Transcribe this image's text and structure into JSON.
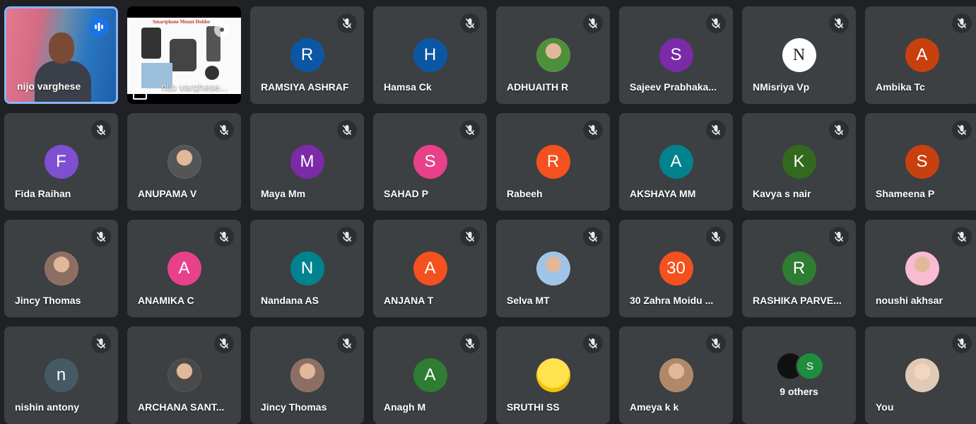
{
  "colors": {
    "tile_bg": "#3c4043",
    "page_bg": "#202124",
    "active_border": "#8ab4f8",
    "speaking": "#1a73e8"
  },
  "self_video": {
    "name": "nijo varghese",
    "icon": "audio-level-icon"
  },
  "presentation": {
    "name": "nijo varghese...",
    "slide_title": "Smartphone Mount Holder",
    "icon": "present-screen-icon"
  },
  "participants": [
    {
      "name": "RAMSIYA ASHRAF",
      "initial": "R",
      "color": "#0b57a3"
    },
    {
      "name": "Hamsa Ck",
      "initial": "H",
      "color": "#0b57a3"
    },
    {
      "name": "ADHUAITH R",
      "initial": "",
      "color": "#4e8f3a",
      "photo": "photo-avatar"
    },
    {
      "name": "Sajeev Prabhaka...",
      "initial": "S",
      "color": "#7b2aa8"
    },
    {
      "name": "NMisriya Vp",
      "initial": "N",
      "color": "#ffffff",
      "photo": "letter-n-avatar"
    },
    {
      "name": "Ambika Tc",
      "initial": "A",
      "color": "#c9400f"
    },
    {
      "name": "Fida Raihan",
      "initial": "F",
      "color": "#7e4fd1"
    },
    {
      "name": "ANUPAMA V",
      "initial": "",
      "color": "#555555",
      "photo": "photo-avatar"
    },
    {
      "name": "Maya Mm",
      "initial": "M",
      "color": "#7b2aa8"
    },
    {
      "name": "SAHAD P",
      "initial": "S",
      "color": "#e8418a"
    },
    {
      "name": "Rabeeh",
      "initial": "R",
      "color": "#f4511e"
    },
    {
      "name": "AKSHAYA MM",
      "initial": "A",
      "color": "#00838f"
    },
    {
      "name": "Kavya s nair",
      "initial": "K",
      "color": "#33691e"
    },
    {
      "name": "Shameena P",
      "initial": "S",
      "color": "#c9400f"
    },
    {
      "name": "Jincy Thomas",
      "initial": "",
      "color": "#8d6e63",
      "photo": "photo-avatar"
    },
    {
      "name": "ANAMIKA C",
      "initial": "A",
      "color": "#e8418a"
    },
    {
      "name": "Nandana AS",
      "initial": "N",
      "color": "#00838f"
    },
    {
      "name": "ANJANA T",
      "initial": "A",
      "color": "#f4511e"
    },
    {
      "name": "Selva MT",
      "initial": "",
      "color": "#9ec5e8",
      "photo": "photo-avatar"
    },
    {
      "name": "30 Zahra Moidu ...",
      "initial": "30",
      "color": "#f4511e"
    },
    {
      "name": "RASHIKA PARVE...",
      "initial": "R",
      "color": "#2e7d32"
    },
    {
      "name": "noushi akhsar",
      "initial": "",
      "color": "#f8bbd0",
      "photo": "photo-avatar"
    },
    {
      "name": "nishin antony",
      "initial": "n",
      "color": "#455a64"
    },
    {
      "name": "ARCHANA SANT...",
      "initial": "",
      "color": "#4a4a4a",
      "photo": "photo-avatar"
    },
    {
      "name": "Jincy Thomas",
      "initial": "",
      "color": "#8d6e63",
      "photo": "photo-avatar"
    },
    {
      "name": "Anagh M",
      "initial": "A",
      "color": "#2e7d32"
    },
    {
      "name": "SRUTHI SS",
      "initial": "",
      "color": "#ffd600",
      "photo": "emoji-avatar"
    },
    {
      "name": "Ameya k k",
      "initial": "",
      "color": "#b08968",
      "photo": "photo-avatar"
    }
  ],
  "others": {
    "label": "9 others",
    "avatar_initial": "S",
    "avatar_color": "#1e8e3e"
  },
  "self_tile": {
    "name": "You",
    "color": "#e0c9b5"
  }
}
